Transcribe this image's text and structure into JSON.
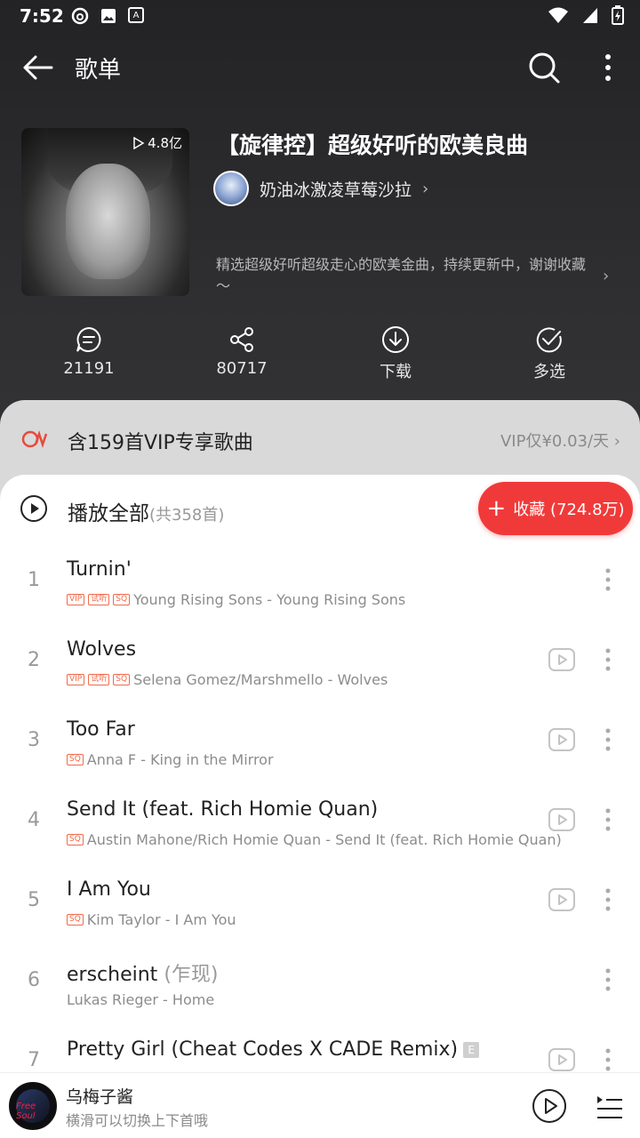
{
  "status_bar": {
    "time": "7:52"
  },
  "header": {
    "title": "歌单"
  },
  "playlist": {
    "play_count": "4.8亿",
    "title": "【旋律控】超级好听的欧美良曲",
    "creator": "奶油冰激凌草莓沙拉",
    "description": "精选超级好听超级走心的欧美金曲，持续更新中，谢谢收藏～"
  },
  "actions": [
    {
      "label": "21191",
      "icon": "comment-icon"
    },
    {
      "label": "80717",
      "icon": "share-icon"
    },
    {
      "label": "下载",
      "icon": "download-icon"
    },
    {
      "label": "多选",
      "icon": "multi-select-icon"
    }
  ],
  "vip": {
    "text": "含159首VIP专享歌曲",
    "price": "VIP仅¥0.03/天"
  },
  "play_all": {
    "label": "播放全部",
    "count": "(共358首)"
  },
  "collect": {
    "label": "收藏 (724.8万)"
  },
  "songs": [
    {
      "index": "1",
      "title": "Turnin'",
      "alias": "",
      "tags": [
        "VIP",
        "试听",
        "SQ"
      ],
      "subtitle": "Young Rising Sons - Young Rising Sons",
      "has_mv": false
    },
    {
      "index": "2",
      "title": "Wolves",
      "alias": "",
      "tags": [
        "VIP",
        "试听",
        "SQ"
      ],
      "subtitle": "Selena Gomez/Marshmello - Wolves",
      "has_mv": true
    },
    {
      "index": "3",
      "title": "Too Far",
      "alias": "",
      "tags": [
        "SQ"
      ],
      "subtitle": "Anna F - King in the Mirror",
      "has_mv": true
    },
    {
      "index": "4",
      "title": "Send It (feat. Rich Homie Quan)",
      "alias": "",
      "tags": [
        "SQ"
      ],
      "subtitle": "Austin Mahone/Rich Homie Quan - Send It (feat. Rich Homie Quan)",
      "has_mv": true
    },
    {
      "index": "5",
      "title": "I Am You",
      "alias": "",
      "tags": [
        "SQ"
      ],
      "subtitle": "Kim Taylor - I Am You",
      "has_mv": true
    },
    {
      "index": "6",
      "title": "erscheint",
      "alias": "(乍现)",
      "tags": [],
      "subtitle": "Lukas Rieger - Home",
      "has_mv": false
    },
    {
      "index": "7",
      "title": "Pretty Girl (Cheat Codes X CADE Remix)",
      "alias": "",
      "tags": [],
      "subtitle": "",
      "has_mv": true,
      "explicit": "E"
    }
  ],
  "player": {
    "song": "乌梅子酱",
    "hint": "横滑可以切换上下首哦",
    "art_text": "Free Soul"
  }
}
